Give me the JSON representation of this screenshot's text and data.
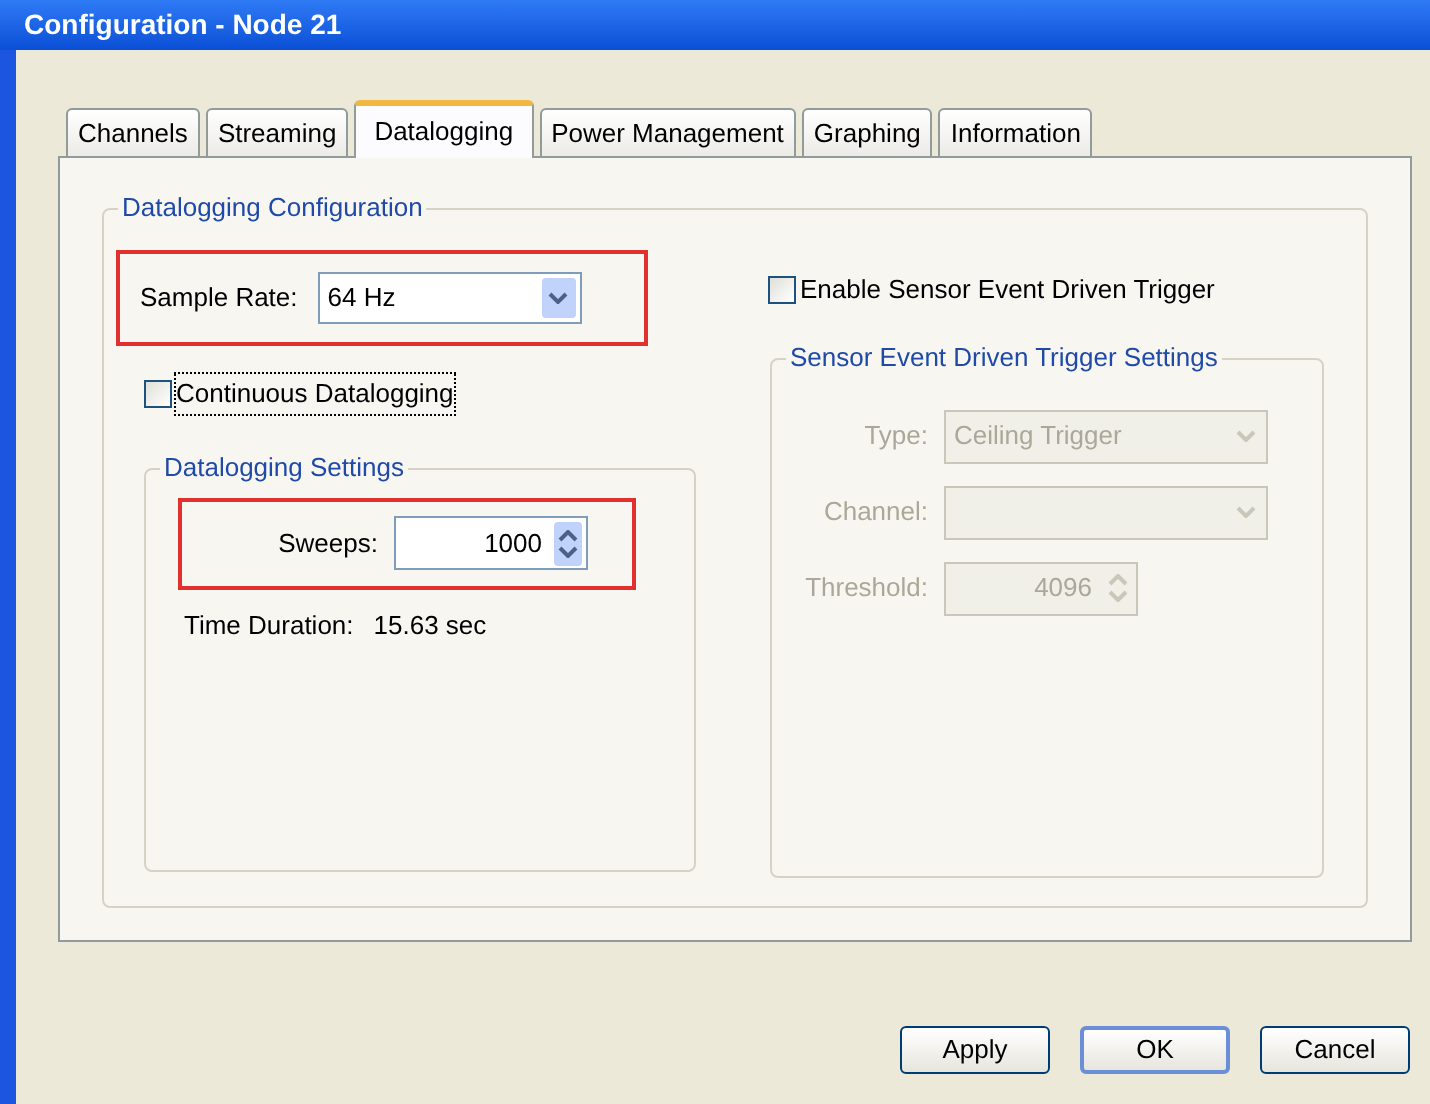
{
  "window": {
    "title": "Configuration - Node 21"
  },
  "tabs": [
    {
      "label": "Channels",
      "selected": false
    },
    {
      "label": "Streaming",
      "selected": false
    },
    {
      "label": "Datalogging",
      "selected": true
    },
    {
      "label": "Power Management",
      "selected": false
    },
    {
      "label": "Graphing",
      "selected": false
    },
    {
      "label": "Information",
      "selected": false
    }
  ],
  "datalogging_configuration": {
    "legend": "Datalogging Configuration",
    "sample_rate": {
      "label": "Sample Rate:",
      "value": "64 Hz",
      "highlighted": true
    },
    "continuous_datalogging": {
      "label": "Continuous Datalogging",
      "checked": false
    },
    "datalogging_settings": {
      "legend": "Datalogging Settings",
      "sweeps": {
        "label": "Sweeps:",
        "value": "1000",
        "highlighted": true
      },
      "time_duration": {
        "label": "Time Duration:",
        "value": "15.63 sec"
      }
    },
    "enable_trigger": {
      "label": "Enable Sensor Event Driven Trigger",
      "checked": false
    },
    "trigger_settings": {
      "legend": "Sensor Event Driven Trigger Settings",
      "disabled": true,
      "type": {
        "label": "Type:",
        "value": "Ceiling Trigger"
      },
      "channel": {
        "label": "Channel:"
      },
      "threshold": {
        "label": "Threshold:",
        "value": "4096"
      }
    }
  },
  "buttons": [
    {
      "label": "Apply",
      "default": false
    },
    {
      "label": "OK",
      "default": true
    },
    {
      "label": "Cancel",
      "default": false
    }
  ]
}
